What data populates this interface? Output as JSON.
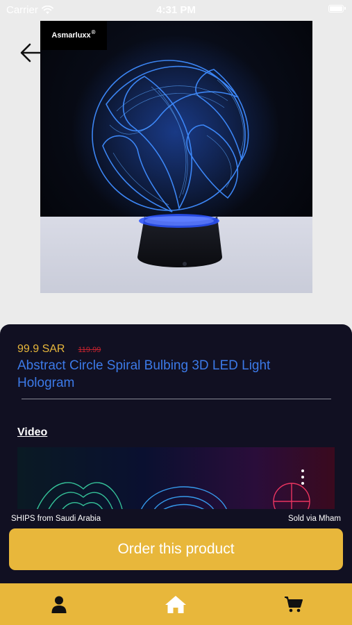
{
  "status_bar": {
    "carrier": "Carrier",
    "time": "4:31 PM"
  },
  "product": {
    "brand": "Asmarluxx",
    "brand_mark": "®",
    "price": "99.9 SAR",
    "old_price": "119.99",
    "title": "Abstract Circle Spiral Bulbing 3D LED Light Hologram"
  },
  "video": {
    "label": "Video"
  },
  "order": {
    "ships_from": "SHIPS from Saudi Arabia",
    "sold_via": "Sold via Mham",
    "button_label": "Order this product"
  },
  "bottom_nav": {
    "items": [
      {
        "icon": "user-icon"
      },
      {
        "icon": "home-icon"
      },
      {
        "icon": "cart-icon"
      }
    ]
  },
  "colors": {
    "accent": "#e8b73b",
    "sheet_background": "#111022",
    "title_blue": "#3c7ae8",
    "old_price_red": "#c8232f"
  }
}
